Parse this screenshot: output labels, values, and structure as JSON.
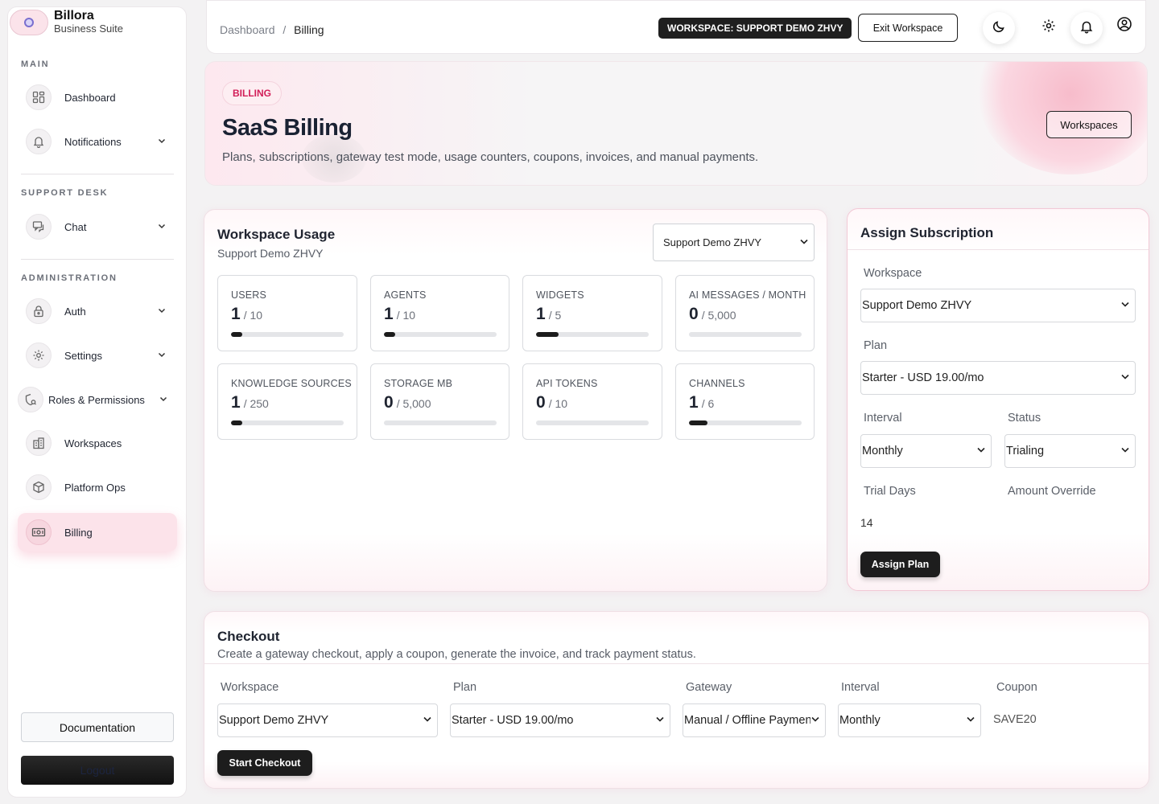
{
  "brand": {
    "name": "Billora",
    "subtitle": "Business Suite"
  },
  "sidebar": {
    "sections": {
      "main": "MAIN",
      "support": "SUPPORT DESK",
      "admin": "ADMINISTRATION"
    },
    "items": [
      {
        "label": "Dashboard",
        "icon": "dashboard-icon"
      },
      {
        "label": "Notifications",
        "icon": "bell-icon"
      },
      {
        "label": "Chat",
        "icon": "chat-icon"
      },
      {
        "label": "Auth",
        "icon": "lock-icon"
      },
      {
        "label": "Settings",
        "icon": "gear-icon"
      },
      {
        "label": "Roles & Permissions",
        "icon": "shield-icon"
      },
      {
        "label": "Workspaces",
        "icon": "building-icon"
      },
      {
        "label": "Platform Ops",
        "icon": "cube-icon"
      },
      {
        "label": "Billing",
        "icon": "money-icon",
        "active": true
      }
    ],
    "documentation": "Documentation",
    "logout": "Logout"
  },
  "topbar": {
    "breadcrumb_root": "Dashboard",
    "breadcrumb_sep": "/",
    "breadcrumb_current": "Billing",
    "workspace_badge": "WORKSPACE: SUPPORT DEMO ZHVY",
    "exit_button": "Exit Workspace"
  },
  "hero": {
    "tag": "BILLING",
    "title": "SaaS Billing",
    "subtitle": "Plans, subscriptions, gateway test mode, usage counters, coupons, invoices, and manual payments.",
    "button": "Workspaces"
  },
  "usage": {
    "title": "Workspace Usage",
    "subtitle": "Support Demo ZHVY",
    "workspace_select": "Support Demo ZHVY",
    "metrics": [
      {
        "label": "USERS",
        "value": "1",
        "max": "/ 10",
        "fraction": 0.1
      },
      {
        "label": "AGENTS",
        "value": "1",
        "max": "/ 10",
        "fraction": 0.1
      },
      {
        "label": "WIDGETS",
        "value": "1",
        "max": "/ 5",
        "fraction": 0.2
      },
      {
        "label": "AI MESSAGES / MONTH",
        "value": "0",
        "max": "/ 5,000",
        "fraction": 0
      },
      {
        "label": "KNOWLEDGE SOURCES",
        "value": "1",
        "max": "/ 250",
        "fraction": 0.004
      },
      {
        "label": "STORAGE MB",
        "value": "0",
        "max": "/ 5,000",
        "fraction": 0
      },
      {
        "label": "API TOKENS",
        "value": "0",
        "max": "/ 10",
        "fraction": 0
      },
      {
        "label": "CHANNELS",
        "value": "1",
        "max": "/ 6",
        "fraction": 0.167
      }
    ]
  },
  "assign": {
    "title": "Assign Subscription",
    "workspace_label": "Workspace",
    "workspace_value": "Support Demo ZHVY",
    "plan_label": "Plan",
    "plan_value": "Starter - USD 19.00/mo",
    "interval_label": "Interval",
    "interval_value": "Monthly",
    "status_label": "Status",
    "status_value": "Trialing",
    "trial_label": "Trial Days",
    "trial_value": "14",
    "amount_label": "Amount Override",
    "amount_value": "",
    "button": "Assign Plan"
  },
  "checkout": {
    "title": "Checkout",
    "subtitle": "Create a gateway checkout, apply a coupon, generate the invoice, and track payment status.",
    "workspace_label": "Workspace",
    "workspace_value": "Support Demo ZHVY",
    "plan_label": "Plan",
    "plan_value": "Starter - USD 19.00/mo",
    "gateway_label": "Gateway",
    "gateway_value": "Manual / Offline Payment",
    "interval_label": "Interval",
    "interval_value": "Monthly",
    "coupon_label": "Coupon",
    "coupon_value": "SAVE20",
    "button": "Start Checkout"
  }
}
